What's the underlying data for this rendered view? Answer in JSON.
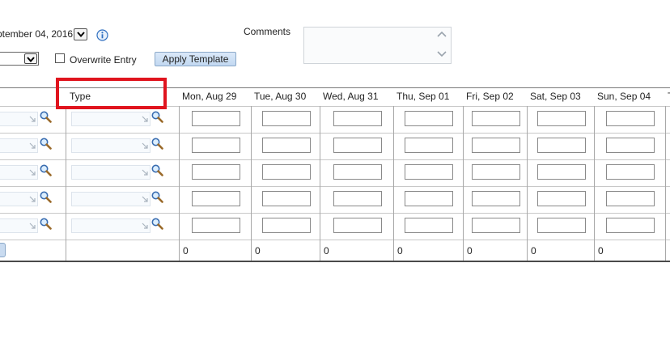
{
  "header": {
    "period_text": "ptember 04, 2016",
    "overwrite_label": "Overwrite Entry",
    "apply_template_label": "Apply Template",
    "comments_label": "Comments"
  },
  "grid": {
    "type_header": "Type",
    "days": [
      {
        "label": "Mon, Aug 29",
        "total": "0"
      },
      {
        "label": "Tue, Aug 30",
        "total": "0"
      },
      {
        "label": "Wed, Aug 31",
        "total": "0"
      },
      {
        "label": "Thu, Sep 01",
        "total": "0"
      },
      {
        "label": "Fri, Sep 02",
        "total": "0"
      },
      {
        "label": "Sat, Sep 03",
        "total": "0"
      },
      {
        "label": "Sun, Sep 04",
        "total": "0"
      }
    ],
    "next_header_partial": "T"
  },
  "icons": {
    "info": "info-icon",
    "lookup": "magnifier-icon",
    "dropdown": "chevron-down-icon",
    "scroll_up": "chevron-up-icon",
    "scroll_down": "chevron-down-icon"
  },
  "colors": {
    "highlight": "#e0141e",
    "button_bg": "#c9dbf0",
    "info_blue": "#2f6fc0"
  }
}
